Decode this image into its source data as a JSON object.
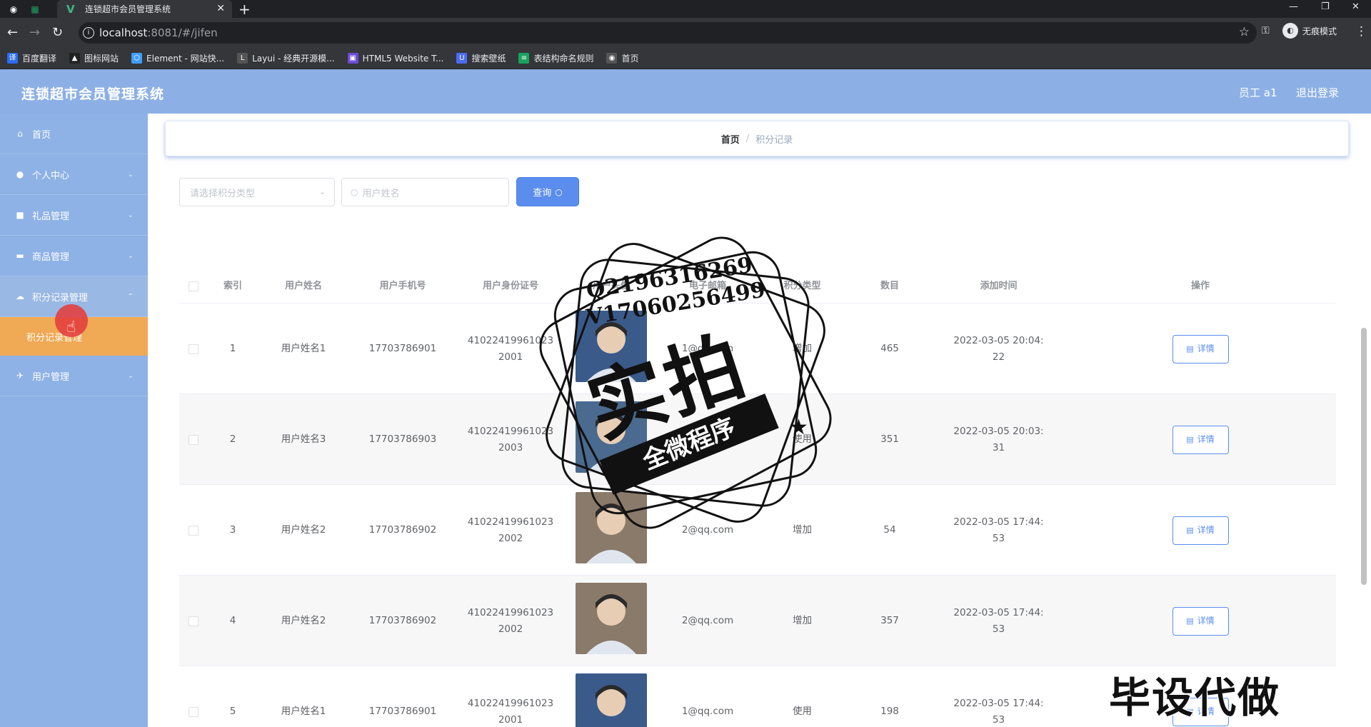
{
  "browser": {
    "tab_title": "连锁超市会员管理系统",
    "url_host": "localhost",
    "url_rest": ":8081/#/jifen",
    "incognito_label": "无痕模式",
    "bookmarks": [
      {
        "label": "百度翻译",
        "color": "#2b6cf6",
        "glyph": "译"
      },
      {
        "label": "图标网站",
        "color": "#222222",
        "glyph": "▲"
      },
      {
        "label": "Element - 网站快...",
        "color": "#409eff",
        "glyph": "⬡"
      },
      {
        "label": "Layui - 经典开源模...",
        "color": "#555555",
        "glyph": "L"
      },
      {
        "label": "HTML5 Website T...",
        "color": "#6c4bd6",
        "glyph": "▣"
      },
      {
        "label": "搜索壁纸",
        "color": "#4a6cf7",
        "glyph": "U"
      },
      {
        "label": "表结构命名规则",
        "color": "#1aa260",
        "glyph": "≡"
      },
      {
        "label": "首页",
        "color": "#555555",
        "glyph": "◉"
      }
    ]
  },
  "header": {
    "title": "连锁超市会员管理系统",
    "user": "员工 a1",
    "logout": "退出登录"
  },
  "sidebar": {
    "items": [
      {
        "label": "首页",
        "icon": "home-icon"
      },
      {
        "label": "个人中心",
        "icon": "user-icon"
      },
      {
        "label": "礼品管理",
        "icon": "gift-icon"
      },
      {
        "label": "商品管理",
        "icon": "goods-icon"
      },
      {
        "label": "积分记录管理",
        "icon": "points-icon"
      },
      {
        "label": "用户管理",
        "icon": "users-icon"
      }
    ],
    "sub_item": "积分记录管理"
  },
  "breadcrumb": {
    "home": "首页",
    "separator": "/",
    "current": "积分记录"
  },
  "filters": {
    "type_placeholder": "请选择积分类型",
    "name_placeholder": "用户姓名",
    "query_label": "查询"
  },
  "table": {
    "headers": [
      "索引",
      "用户姓名",
      "用户手机号",
      "用户身份证号",
      "用户头像",
      "电子邮箱",
      "积分类型",
      "数目",
      "添加时间",
      "操作"
    ],
    "detail_label": "详情",
    "rows": [
      {
        "index": "1",
        "name": "用户姓名1",
        "phone": "17703786901",
        "id1": "41022419961023",
        "id2": "2001",
        "email": "1@qq.com",
        "type": "增加",
        "count": "465",
        "t1": "2022-03-05 20:04:",
        "t2": "22",
        "avatar": "a1"
      },
      {
        "index": "2",
        "name": "用户姓名3",
        "phone": "17703786903",
        "id1": "41022419961023",
        "id2": "2003",
        "email": "3@qq.com",
        "type": "使用",
        "count": "351",
        "t1": "2022-03-05 20:03:",
        "t2": "31",
        "avatar": "a3"
      },
      {
        "index": "3",
        "name": "用户姓名2",
        "phone": "17703786902",
        "id1": "41022419961023",
        "id2": "2002",
        "email": "2@qq.com",
        "type": "增加",
        "count": "54",
        "t1": "2022-03-05 17:44:",
        "t2": "53",
        "avatar": "a2"
      },
      {
        "index": "4",
        "name": "用户姓名2",
        "phone": "17703786902",
        "id1": "41022419961023",
        "id2": "2002",
        "email": "2@qq.com",
        "type": "增加",
        "count": "357",
        "t1": "2022-03-05 17:44:",
        "t2": "53",
        "avatar": "a2"
      },
      {
        "index": "5",
        "name": "用户姓名1",
        "phone": "17703786901",
        "id1": "41022419961023",
        "id2": "2001",
        "email": "1@qq.com",
        "type": "使用",
        "count": "198",
        "t1": "2022-03-05 17:44:",
        "t2": "53",
        "avatar": "a1"
      }
    ]
  },
  "watermark": {
    "line1": "Q2196316269",
    "line2": "V17060256499",
    "big": "实拍",
    "ribbon": "全微程序",
    "corner": "毕设代做"
  }
}
